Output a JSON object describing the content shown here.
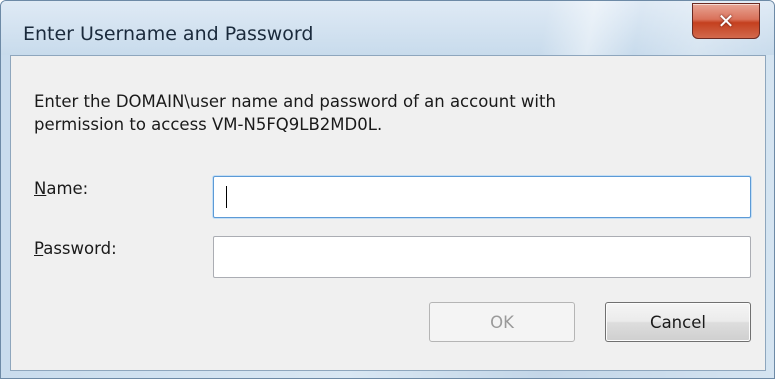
{
  "window": {
    "title": "Enter Username and Password",
    "close_icon": "✕"
  },
  "dialog": {
    "message_line1": "Enter the DOMAIN\\user name and password of an account with",
    "message_line2": "permission to access VM-N5FQ9LB2MD0L.",
    "name_label_accel": "N",
    "name_label_rest": "ame:",
    "name_value": "",
    "password_label_accel": "P",
    "password_label_rest": "assword:",
    "password_value": "",
    "ok_label": "OK",
    "cancel_label": "Cancel"
  },
  "icons": {
    "close": "close-icon"
  }
}
